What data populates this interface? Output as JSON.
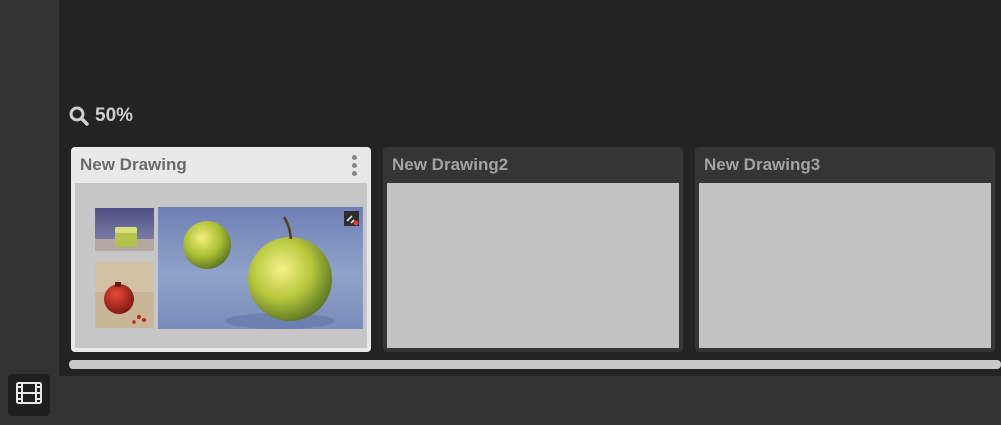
{
  "zoom": {
    "icon": "search-icon",
    "label": "50%"
  },
  "cards": [
    {
      "title": "New Drawing",
      "selected": true,
      "menu_icon": "more-vertical-icon",
      "badge_icon": "sync-error-icon"
    },
    {
      "title": "New Drawing2",
      "selected": false
    },
    {
      "title": "New Drawing3",
      "selected": false
    }
  ],
  "bottom_bar": {
    "film_icon": "filmstrip-icon"
  },
  "colors": {
    "panel_bg": "#232323",
    "chrome_bg": "#333333",
    "selected_card": "#e9e9e9",
    "thumb_placeholder": "#c2c2c2"
  }
}
